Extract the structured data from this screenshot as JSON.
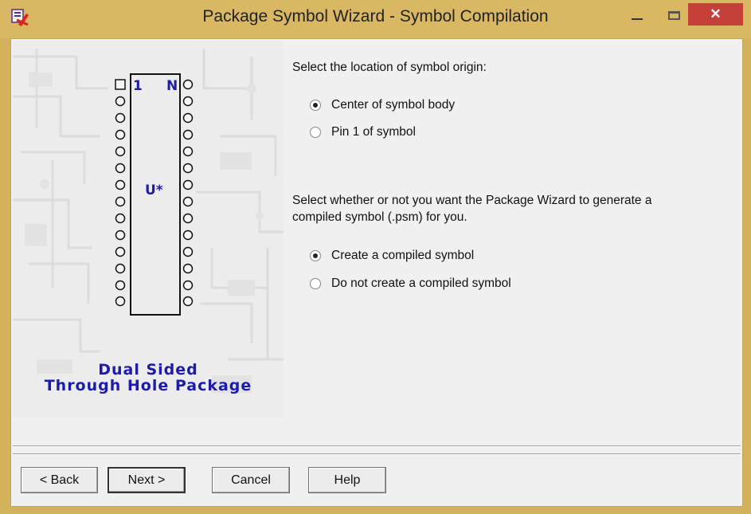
{
  "window": {
    "title": "Package Symbol Wizard - Symbol Compilation",
    "close_glyph": "✕"
  },
  "artwork": {
    "pin_first": "1",
    "pin_last": "N",
    "ref_designator": "U*",
    "caption_line1": "Dual Sided",
    "caption_line2": "Through Hole Package"
  },
  "origin": {
    "prompt": "Select the location of symbol origin:",
    "options": [
      {
        "label": "Center of symbol body",
        "selected": true
      },
      {
        "label": "Pin 1 of symbol",
        "selected": false
      }
    ]
  },
  "compile": {
    "prompt": "Select whether or not you want the Package Wizard to generate a compiled symbol (.psm) for you.",
    "options": [
      {
        "label": "Create a compiled symbol",
        "selected": true
      },
      {
        "label": "Do not create a compiled symbol",
        "selected": false
      }
    ]
  },
  "buttons": {
    "back": "< Back",
    "next": "Next >",
    "cancel": "Cancel",
    "help": "Help"
  },
  "colors": {
    "titlebar": "#dab763",
    "close": "#c6403a",
    "package_text": "#1c1ca8"
  }
}
